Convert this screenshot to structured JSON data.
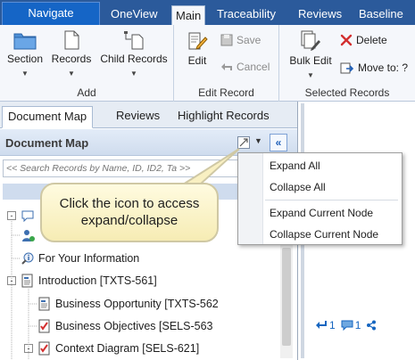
{
  "ribbon_tabs": {
    "navigate": "Navigate",
    "oneview": "OneView",
    "main": "Main",
    "traceability": "Traceability",
    "reviews": "Reviews",
    "baseline": "Baseline"
  },
  "ribbon": {
    "add_group": {
      "label": "Add",
      "section": "Section",
      "records": "Records",
      "child_records": "Child Records"
    },
    "edit_group": {
      "label": "Edit Record",
      "edit": "Edit",
      "save": "Save",
      "cancel": "Cancel"
    },
    "selected_group": {
      "label": "Selected Records",
      "bulk_edit": "Bulk Edit",
      "delete": "Delete",
      "move_to": "Move to: ?"
    }
  },
  "panel_tabs": {
    "document_map": "Document Map",
    "reviews": "Reviews",
    "highlight_records": "Highlight Records"
  },
  "document_map": {
    "title": "Document Map",
    "search_placeholder": "<< Search Records by Name, ID, ID2, Ta >>"
  },
  "tree": [
    {
      "label": "",
      "expander": "-",
      "icon": "chat-icon"
    },
    {
      "label": "",
      "expander": "",
      "icon": "user-icon"
    },
    {
      "label": "For Your Information",
      "expander": "",
      "icon": "info-icon"
    },
    {
      "label": "Introduction [TXTS-561]",
      "expander": "-",
      "icon": "text-doc-icon"
    },
    {
      "label": "Business Opportunity [TXTS-562",
      "expander": "",
      "icon": "text-doc-icon"
    },
    {
      "label": "Business Objectives [SELS-563",
      "expander": "",
      "icon": "checklist-icon"
    },
    {
      "label": "Context Diagram [SELS-621]",
      "expander": "-",
      "icon": "checklist-icon"
    }
  ],
  "dropdown_menu": {
    "expand_all": "Expand All",
    "collapse_all": "Collapse All",
    "expand_current_node": "Expand Current Node",
    "collapse_current_node": "Collapse Current Node"
  },
  "callout": {
    "line1": "Click the icon to access",
    "line2": "expand/collapse"
  },
  "counts": {
    "links": "1",
    "comments": "1"
  },
  "colors": {
    "tab_bar": "#2b5a9b",
    "navigate_tab": "#1565c6",
    "accent_blue": "#1f5fb8",
    "delete_red": "#d32f2f",
    "callout_fill": "#fbf3c8"
  }
}
